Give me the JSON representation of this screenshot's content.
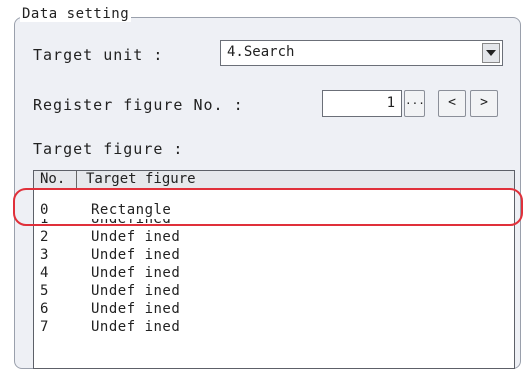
{
  "group": {
    "legend": "Data setting"
  },
  "target_unit": {
    "label": "Target unit :",
    "value": "4.Search"
  },
  "register_figure": {
    "label": "Register figure No. :",
    "value": "1",
    "ellipsis_label": "...",
    "prev_label": "<",
    "next_label": ">"
  },
  "target_figure": {
    "label": "Target figure :",
    "columns": [
      "No.",
      "Target figure"
    ],
    "rows": [
      {
        "no": "0",
        "name": "Rectangle"
      },
      {
        "no": "1",
        "name": "Undefined"
      },
      {
        "no": "2",
        "name": "Undef ined"
      },
      {
        "no": "3",
        "name": "Undef ined"
      },
      {
        "no": "4",
        "name": "Undef ined"
      },
      {
        "no": "5",
        "name": "Undef ined"
      },
      {
        "no": "6",
        "name": "Undef ined"
      },
      {
        "no": "7",
        "name": "Undef ined"
      }
    ]
  },
  "colors": {
    "highlight": "#e0303a",
    "panel": "#eef0f5"
  }
}
